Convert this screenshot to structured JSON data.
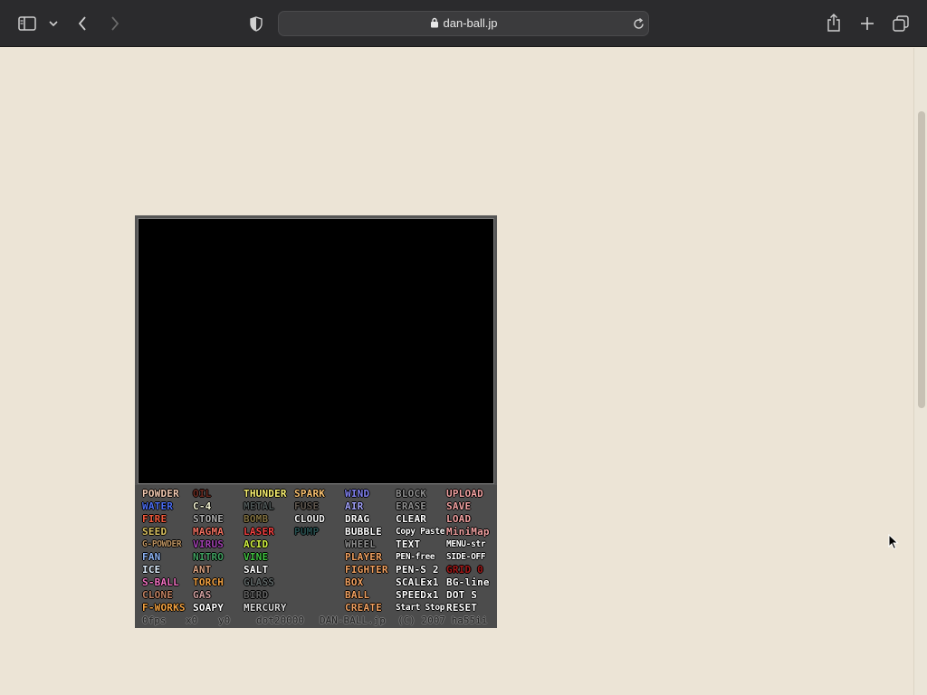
{
  "browser": {
    "url": "dan-ball.jp",
    "icons": [
      "sidebar-icon",
      "chevron-down-icon",
      "back-icon",
      "forward-icon",
      "shield-icon",
      "lock-icon",
      "reload-icon",
      "share-icon",
      "plus-icon",
      "tabs-icon"
    ]
  },
  "game": {
    "columns": [
      [
        {
          "label": "POWDER",
          "color": "#f0c8b0"
        },
        {
          "label": "WATER",
          "color": "#4a6cf0"
        },
        {
          "label": "FIRE",
          "color": "#f05a3c"
        },
        {
          "label": "SEED",
          "color": "#d8c060"
        },
        {
          "label": "G-POWDER",
          "color": "#b89060"
        },
        {
          "label": "FAN",
          "color": "#8ab0f0"
        },
        {
          "label": "ICE",
          "color": "#e0f0ff"
        },
        {
          "label": "S-BALL",
          "color": "#f070c0"
        },
        {
          "label": "CLONE",
          "color": "#c08060"
        },
        {
          "label": "F-WORKS",
          "color": "#f0a040"
        }
      ],
      [
        {
          "label": "OIL",
          "color": "#6a2a20"
        },
        {
          "label": "C-4",
          "color": "#f0f0d0"
        },
        {
          "label": "STONE",
          "color": "#b0b0b0"
        },
        {
          "label": "MAGMA",
          "color": "#f07060"
        },
        {
          "label": "VIRUS",
          "color": "#a040b0"
        },
        {
          "label": "NITRO",
          "color": "#40a060"
        },
        {
          "label": "ANT",
          "color": "#d8a080"
        },
        {
          "label": "TORCH",
          "color": "#f0a040"
        },
        {
          "label": "GAS",
          "color": "#d0a0a0"
        },
        {
          "label": "SOAPY",
          "color": "#ffffff"
        }
      ],
      [
        {
          "label": "THUNDER",
          "color": "#f8f070"
        },
        {
          "label": "METAL",
          "color": "#505858"
        },
        {
          "label": "BOMB",
          "color": "#807040"
        },
        {
          "label": "LASER",
          "color": "#f04040"
        },
        {
          "label": "ACID",
          "color": "#d0f040"
        },
        {
          "label": "VINE",
          "color": "#40c040"
        },
        {
          "label": "SALT",
          "color": "#ffffff"
        },
        {
          "label": "GLASS",
          "color": "#606868"
        },
        {
          "label": "BIRD",
          "color": "#606060"
        },
        {
          "label": "MERCURY",
          "color": "#d8d8d8"
        }
      ],
      [
        {
          "label": "SPARK",
          "color": "#f8c070"
        },
        {
          "label": "FUSE",
          "color": "#605850"
        },
        {
          "label": "CLOUD",
          "color": "#f0f0f0"
        },
        {
          "label": "PUMP",
          "color": "#285050"
        }
      ],
      [
        {
          "label": "WIND",
          "color": "#8080f0"
        },
        {
          "label": "AIR",
          "color": "#a0a0f8"
        },
        {
          "label": "DRAG",
          "color": "#ffffff"
        },
        {
          "label": "BUBBLE",
          "color": "#ffffff"
        },
        {
          "label": "WHEEL",
          "color": "#909090"
        },
        {
          "label": "PLAYER",
          "color": "#f0a060"
        },
        {
          "label": "FIGHTER",
          "color": "#f0a060"
        },
        {
          "label": "BOX",
          "color": "#f0a060"
        },
        {
          "label": "BALL",
          "color": "#f0a060"
        },
        {
          "label": "CREATE",
          "color": "#f0a060"
        }
      ],
      [
        {
          "label": "BLOCK",
          "color": "#909090"
        },
        {
          "label": "ERASE",
          "color": "#909090"
        },
        {
          "label": "CLEAR",
          "color": "#ffffff"
        },
        {
          "label": "Copy Paste",
          "color": "#ffffff"
        },
        {
          "label": "TEXT",
          "color": "#ffffff"
        },
        {
          "label": "PEN-free",
          "color": "#ffffff"
        },
        {
          "label": "PEN-S 2",
          "color": "#ffffff"
        },
        {
          "label": "SCALEx1",
          "color": "#ffffff"
        },
        {
          "label": "SPEEDx1",
          "color": "#ffffff"
        },
        {
          "label": "Start Stop",
          "color": "#ffffff"
        }
      ],
      [
        {
          "label": "UPLOAD",
          "color": "#f0a0a0"
        },
        {
          "label": "SAVE",
          "color": "#f0a0a0"
        },
        {
          "label": "LOAD",
          "color": "#f0a0a0"
        },
        {
          "label": "MiniMap",
          "color": "#f0a0a0"
        },
        {
          "label": "MENU-str",
          "color": "#ffffff"
        },
        {
          "label": "SIDE-OFF",
          "color": "#ffffff"
        },
        {
          "label": "GRID 0",
          "color": "#a01818"
        },
        {
          "label": "BG-line",
          "color": "#ffffff"
        },
        {
          "label": "DOT S",
          "color": "#ffffff"
        },
        {
          "label": "RESET",
          "color": "#ffffff"
        }
      ]
    ],
    "status": {
      "fps": "0fps",
      "x": "x0",
      "y": "y0",
      "dots": "dot20000",
      "site": "DAN-BALL.jp",
      "copyright": "(C) 2007 ha55ii"
    }
  }
}
